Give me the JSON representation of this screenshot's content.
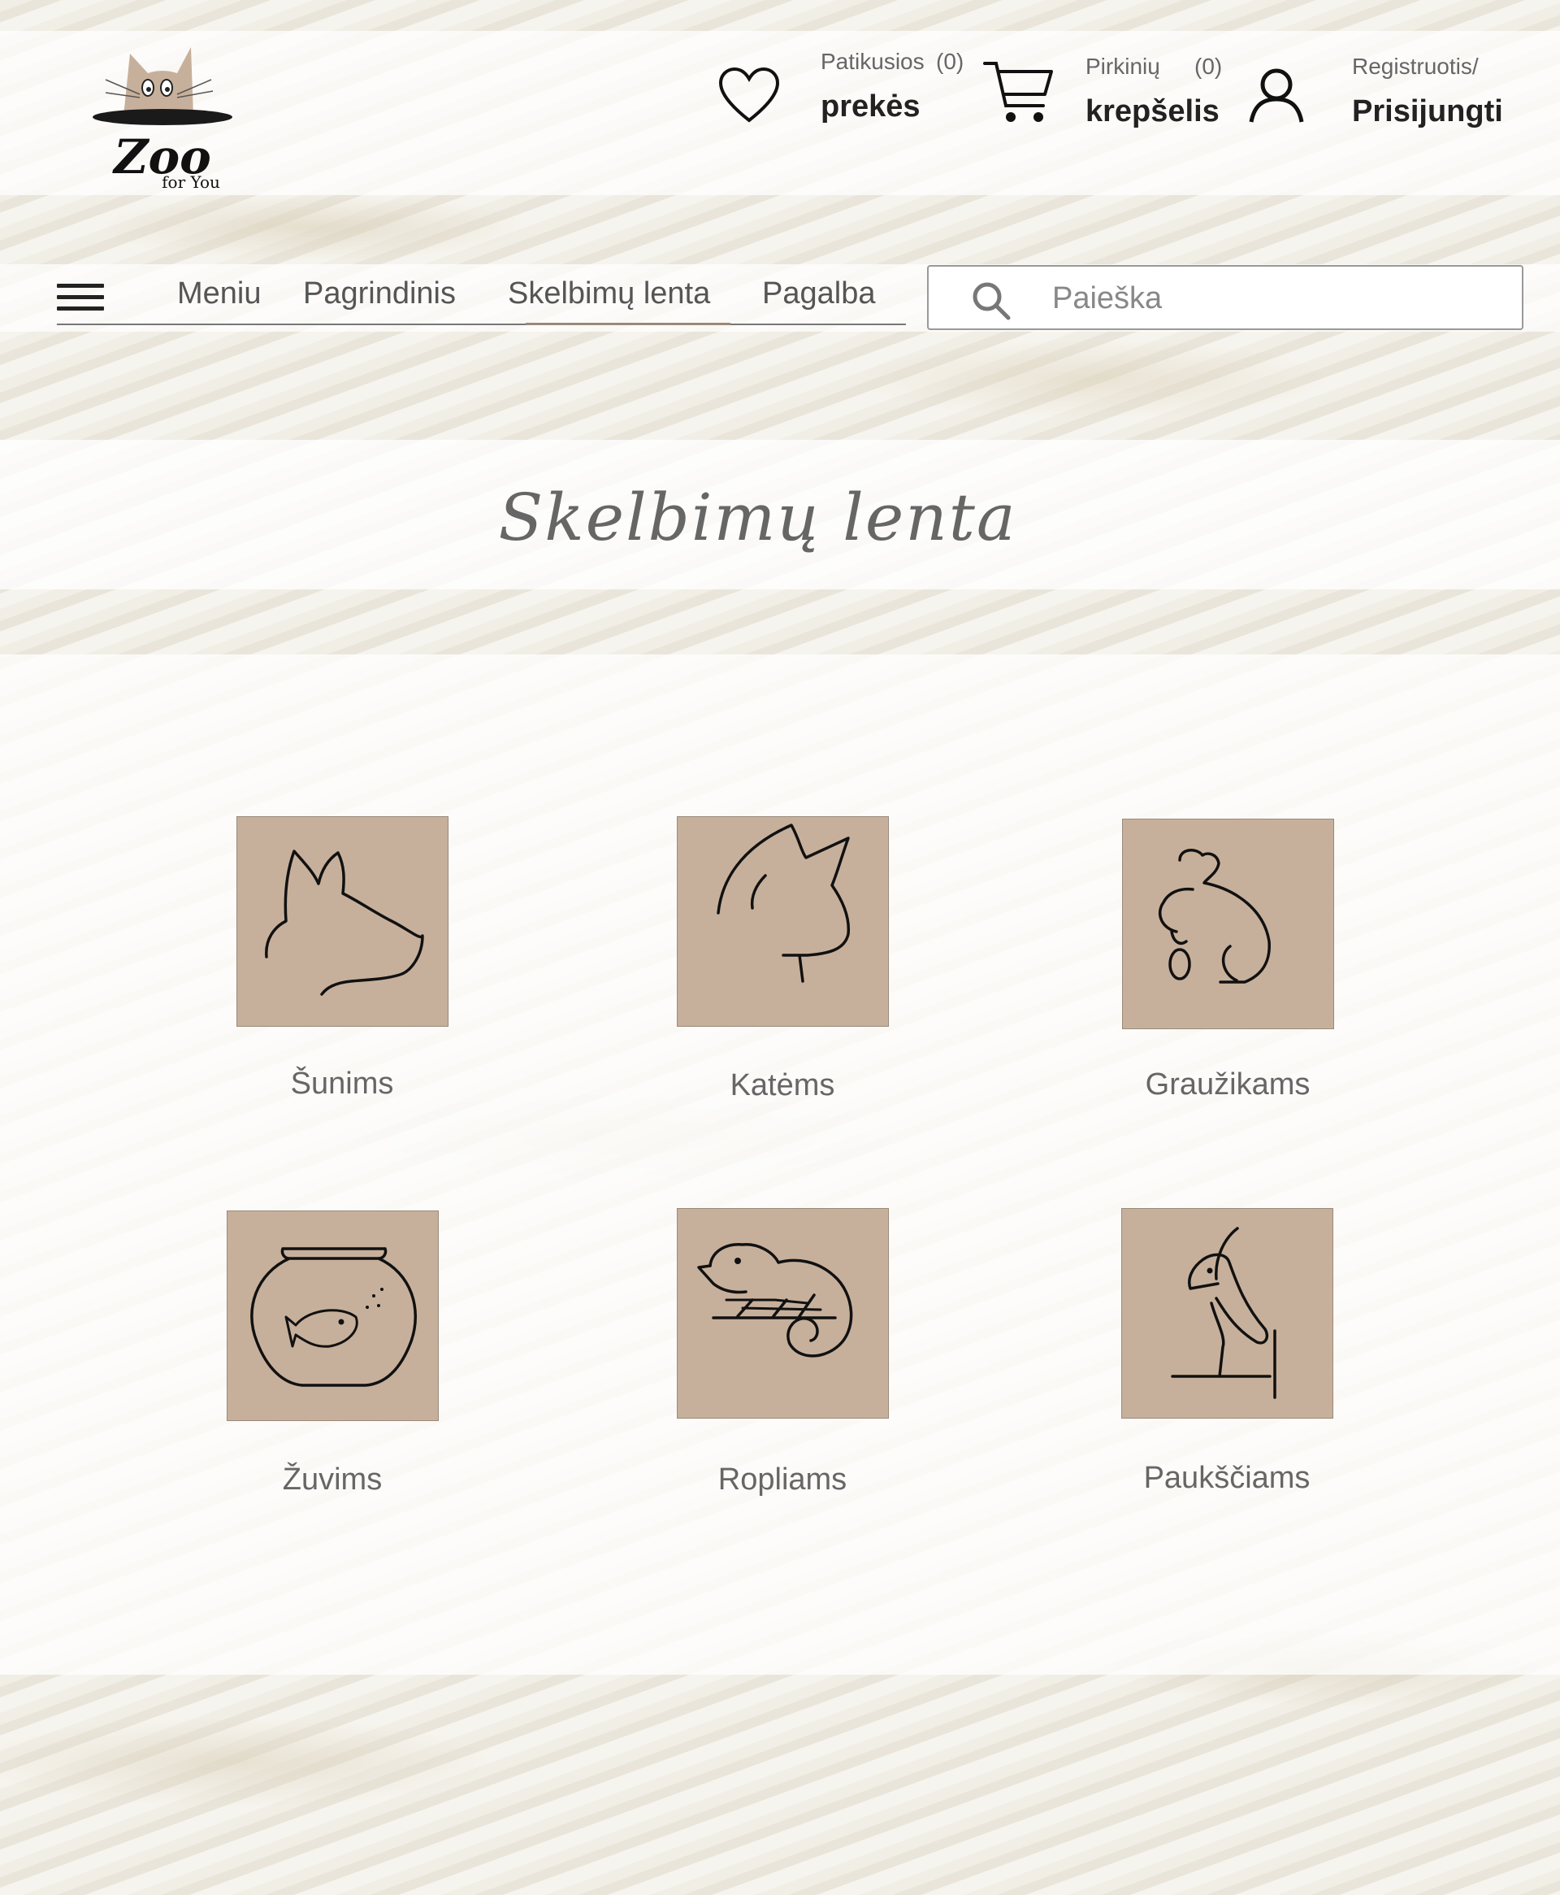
{
  "brand": {
    "logo_title": "Zoo",
    "logo_subtitle": "for You",
    "accent": "#c7b09b"
  },
  "header": {
    "favorites": {
      "small": "Patikusios",
      "count": "(0)",
      "big": "prekės",
      "icon": "heart-icon"
    },
    "cart": {
      "small": "Pirkinių",
      "count": "(0)",
      "big": "krepšelis",
      "icon": "cart-icon"
    },
    "account": {
      "small": "Registruotis/",
      "big": "Prisijungti",
      "icon": "user-icon"
    }
  },
  "nav": {
    "menu_icon": "hamburger-icon",
    "items": [
      "Meniu",
      "Pagrindinis",
      "Skelbimų lenta",
      "Pagalba"
    ],
    "active_index": 2
  },
  "search": {
    "placeholder": "Paieška",
    "value": "",
    "icon": "search-icon"
  },
  "page": {
    "title": "Skelbimų lenta"
  },
  "categories": [
    {
      "label": "Šunims",
      "icon": "dog-icon"
    },
    {
      "label": "Katėms",
      "icon": "cat-icon"
    },
    {
      "label": "Graužikams",
      "icon": "rodent-icon"
    },
    {
      "label": "Žuvims",
      "icon": "fish-bowl-icon"
    },
    {
      "label": "Ropliams",
      "icon": "chameleon-icon"
    },
    {
      "label": "Paukščiams",
      "icon": "bird-icon"
    }
  ]
}
